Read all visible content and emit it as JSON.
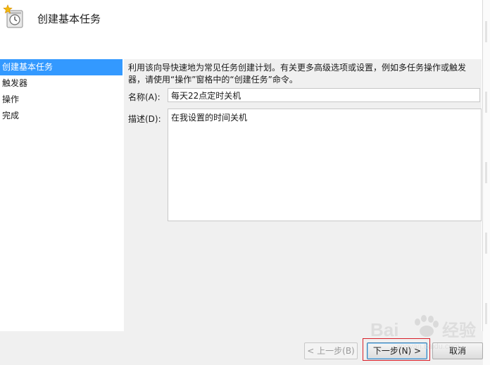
{
  "window": {
    "title": "创建基本任务"
  },
  "nav": {
    "items": [
      {
        "label": "创建基本任务",
        "selected": true
      },
      {
        "label": "触发器",
        "selected": false
      },
      {
        "label": "操作",
        "selected": false
      },
      {
        "label": "完成",
        "selected": false
      }
    ]
  },
  "content": {
    "intro": "利用该向导快速地为常见任务创建计划。有关更多高级选项或设置，例如多任务操作或触发器，请使用“操作”窗格中的“创建任务”命令。",
    "name_label": "名称(A):",
    "name_value": "每天22点定时关机",
    "description_label": "描述(D):",
    "description_value": "在我设置的时间关机"
  },
  "footer": {
    "back_label": "< 上一步(B)",
    "next_label": "下一步(N) >",
    "cancel_label": "取消"
  },
  "watermark": {
    "brand": "Bai",
    "brand2": "经验",
    "sub": "jingyan.baidu.com"
  },
  "colors": {
    "selection": "#3399ff",
    "panel": "#f0f0f0",
    "highlight": "#d8202a"
  }
}
